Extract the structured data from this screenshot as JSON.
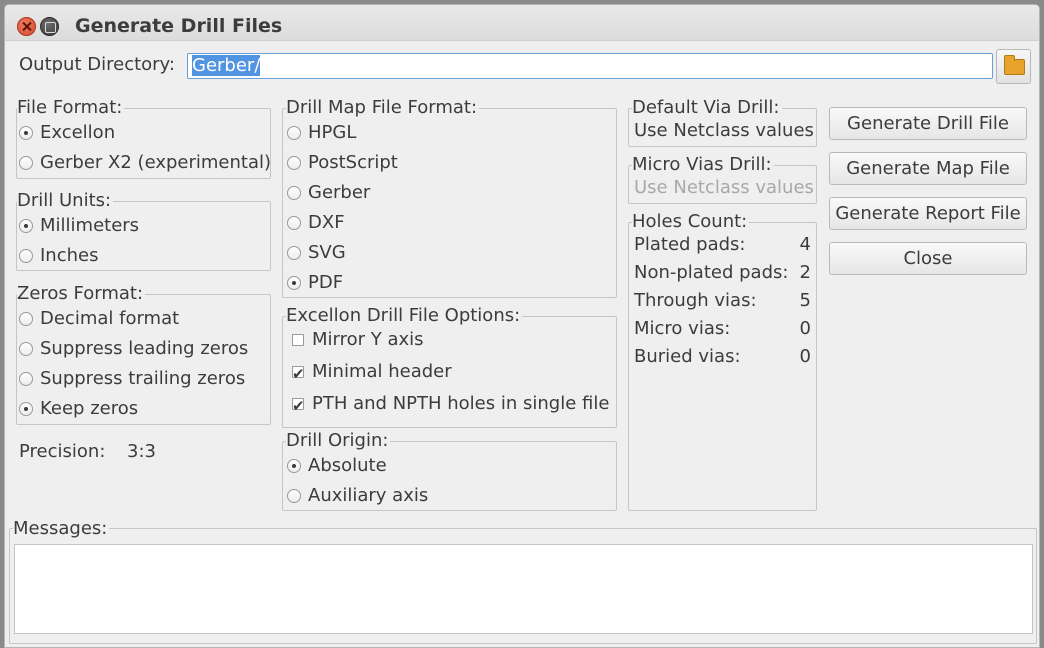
{
  "window": {
    "title": "Generate Drill Files"
  },
  "output": {
    "label": "Output Directory:",
    "value": "Gerber/"
  },
  "file_format": {
    "title": "File Format:",
    "options": [
      {
        "label": "Excellon",
        "selected": true
      },
      {
        "label": "Gerber X2 (experimental)",
        "selected": false
      }
    ]
  },
  "drill_units": {
    "title": "Drill Units:",
    "options": [
      {
        "label": "Millimeters",
        "selected": true
      },
      {
        "label": "Inches",
        "selected": false
      }
    ]
  },
  "zeros_format": {
    "title": "Zeros Format:",
    "options": [
      {
        "label": "Decimal format",
        "selected": false
      },
      {
        "label": "Suppress leading zeros",
        "selected": false
      },
      {
        "label": "Suppress trailing zeros",
        "selected": false
      },
      {
        "label": "Keep zeros",
        "selected": true
      }
    ]
  },
  "precision": {
    "label": "Precision:",
    "value": "3:3"
  },
  "drill_map": {
    "title": "Drill Map File Format:",
    "options": [
      {
        "label": "HPGL",
        "selected": false
      },
      {
        "label": "PostScript",
        "selected": false
      },
      {
        "label": "Gerber",
        "selected": false
      },
      {
        "label": "DXF",
        "selected": false
      },
      {
        "label": "SVG",
        "selected": false
      },
      {
        "label": "PDF",
        "selected": true
      }
    ]
  },
  "excellon_options": {
    "title": "Excellon Drill File Options:",
    "options": [
      {
        "label": "Mirror Y axis",
        "checked": false
      },
      {
        "label": "Minimal header",
        "checked": true
      },
      {
        "label": "PTH and NPTH holes in single file",
        "checked": true
      }
    ]
  },
  "drill_origin": {
    "title": "Drill Origin:",
    "options": [
      {
        "label": "Absolute",
        "selected": true
      },
      {
        "label": "Auxiliary axis",
        "selected": false
      }
    ]
  },
  "default_via": {
    "title": "Default Via Drill:",
    "value": "Use Netclass values"
  },
  "micro_via": {
    "title": "Micro Vias Drill:",
    "value": "Use Netclass values"
  },
  "holes_count": {
    "title": "Holes Count:",
    "rows": [
      {
        "label": "Plated pads:",
        "value": "4"
      },
      {
        "label": "Non-plated pads:",
        "value": "2"
      },
      {
        "label": "Through vias:",
        "value": "5"
      },
      {
        "label": "Micro vias:",
        "value": "0"
      },
      {
        "label": "Buried vias:",
        "value": "0"
      }
    ]
  },
  "buttons": {
    "generate_drill": "Generate Drill File",
    "generate_map": "Generate Map File",
    "generate_report": "Generate Report File",
    "close": "Close"
  },
  "messages": {
    "title": "Messages:"
  },
  "icons": {
    "close": "close-icon",
    "maximize": "maximize-icon",
    "folder": "folder-icon"
  },
  "colors": {
    "selection": "#5294e2",
    "folder": "#e8a32c",
    "close_button": "#e05a3d"
  }
}
